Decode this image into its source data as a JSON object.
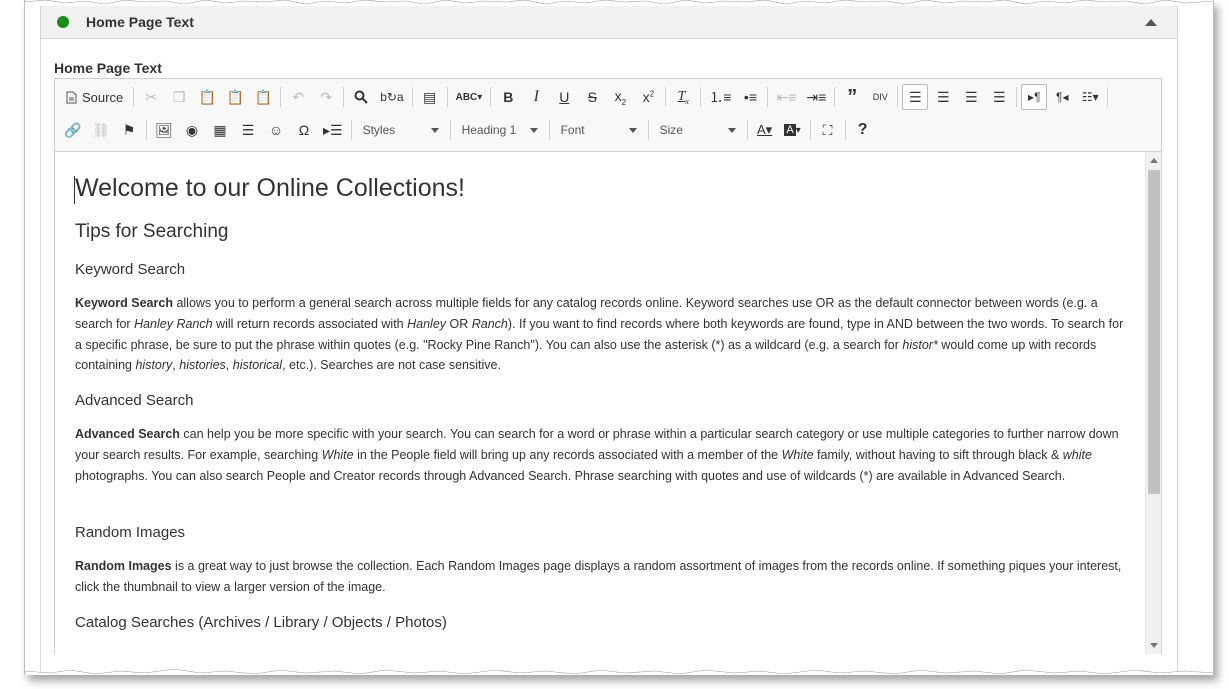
{
  "panel": {
    "title": "Home Page Text",
    "status_color": "#1a8a1a"
  },
  "field": {
    "label": "Home Page Text"
  },
  "toolbar": {
    "source_label": "Source",
    "styles_label": "Styles",
    "format_label": "Heading 1",
    "font_label": "Font",
    "size_label": "Size",
    "help_label": "?",
    "bold_label": "B",
    "italic_label": "I",
    "underline_label": "U",
    "strike_label": "S",
    "omega_label": "Ω"
  },
  "content": {
    "heading1": "Welcome to our Online Collections!",
    "heading2": "Tips for Searching",
    "keyword": {
      "title": "Keyword Search",
      "lead": "Keyword Search",
      "p1": " allows you to perform a general search across multiple fields for any catalog records online. Keyword searches use OR as the default connector between words (e.g. a search for ",
      "ex1": "Hanley Ranch",
      "p2": " will return records associated with ",
      "ex2": "Hanley",
      "p3": " OR ",
      "ex3": "Ranch",
      "p4": "). If you want to find records where both keywords are found, type in AND between the two words. To search for a specific phrase, be sure to put the phrase within quotes (e.g. \"Rocky Pine Ranch\"). You can also use the asterisk (*) as a wildcard (e.g. a search for ",
      "ex4": "histor*",
      "p5": " would come up with records containing ",
      "ex5": "history",
      "sep1": ", ",
      "ex6": "histories",
      "sep2": ", ",
      "ex7": "historical",
      "p6": ", etc.). Searches are not case sensitive."
    },
    "advanced": {
      "title": "Advanced Search",
      "lead": "Advanced Search",
      "p1": " can help you be more specific with your search. You can search for a word or phrase within a particular search category or use multiple categories to further narrow down your search results. For example, searching ",
      "ex1": "White",
      "p2": " in the People field will bring up any records associated with a member of the ",
      "ex2": "White",
      "p3": " family, without having to sift through black & ",
      "ex3": "white",
      "p4": " photographs. You can also search People and Creator records through Advanced Search. Phrase searching with quotes and use of wildcards (*) are available in Advanced Search."
    },
    "random": {
      "title": "Random Images",
      "lead": "Random Images",
      "p1": " is a great way to just browse the collection. Each Random Images page displays a random assortment of images from the records online. If something piques your interest, click the thumbnail to view a larger version of the image."
    },
    "catalog": {
      "title": "Catalog Searches (Archives / Library / Objects / Photos)"
    }
  }
}
